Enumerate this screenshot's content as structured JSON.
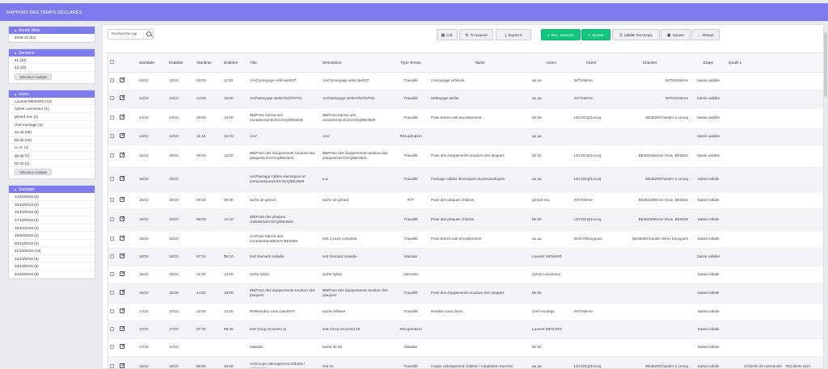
{
  "header": {
    "title": "RAPPORT DES TEMPS DÉCLARÉS"
  },
  "sidebar": {
    "panels": [
      {
        "title": "Année Mois",
        "items": [
          "2019-10 (62)"
        ],
        "multi": ""
      },
      {
        "title": "Semaine",
        "items": [
          "41 (20)",
          "42 (42)"
        ],
        "multi": "Sélection multiple"
      },
      {
        "title": "Users",
        "items": [
          "Laurent MENARD (12)",
          "Sylvie Lanonneur (1)",
          "gérard truc (2)",
          "chef montage (3)",
          "aa aa (26)",
          "bb bb (15)",
          "cc cc (1)",
          "gg gg (1)",
          "hh hh (1)"
        ],
        "multi": "Sélection multiple"
      },
      {
        "title": "Startdate",
        "items": [
          "14/10/2019 (4)",
          "15/10/2019 (2)",
          "16/10/2019 (6)",
          "17/10/2019 (3)",
          "18/10/2019 (2)",
          "19/10/2019 (2)",
          "20/10/2019 (1)",
          "21/10/2019 (13)",
          "22/10/2019 (6)",
          "23/10/2019 (6)",
          "24/10/2019 (8)"
        ],
        "multi": ""
      }
    ]
  },
  "toolbar": {
    "search_placeholder": "Recherche rap",
    "col": "Col.",
    "tri": "Tri avancé",
    "export": "Export",
    "rec": "Rec. avancée",
    "ajouter": "Ajouter",
    "valider": "Valider les temps",
    "sauver": "Sauver",
    "retour": "Retour"
  },
  "table": {
    "columns": [
      "",
      "",
      "Startdate",
      "Enddate",
      "Starttime",
      "Endtime",
      "Title",
      "Description",
      "Type Temps",
      "Tache",
      "Users",
      "Client",
      "Chantier",
      "Etape",
      "Qualif 1",
      ""
    ],
    "rows": [
      [
        "14/10",
        "14/10",
        "09:00",
        "11:00",
        "AA/Convoyage véhicule/INT.",
        "AA/Convoyage véhicule/INT.",
        "Travaillé",
        "Convoyage véhicule",
        "aa aa",
        "INT/Interne",
        "INT01/Interne",
        "Saisie validée",
        "",
        ""
      ],
      [
        "14/10",
        "14/10",
        "14:00",
        "16:00",
        "AA/Nettoyage atelier/INT/INT01",
        "AA/Nettoyage atelier/INT/INT01",
        "Travaillé",
        "Nettoyage atelier",
        "aa aa",
        "INT/Interne",
        "INT01/Interne",
        "Saisie validée",
        "",
        ""
      ],
      [
        "14/10",
        "14/10",
        "09:00",
        "13:00",
        "BB/Pose barres anti enrastrement/LECOCQ/BE3629",
        "BB/Pose barres anti enrastrement/LECOCQ/BE3629",
        "Travaillé",
        "Pose barres anti encastrement",
        "bb bb",
        "LECOCQ/Lecoq",
        "BE3629/Chantier 2 Lecoq",
        "Saisie validée",
        "",
        ""
      ],
      [
        "14/10",
        "14/10",
        "11:15",
        "13:15",
        "AA//",
        "AA//",
        "Récupération",
        "",
        "aa aa",
        "",
        "",
        "Saisie validée",
        "",
        ""
      ],
      [
        "15/10",
        "15/10",
        "09:00",
        "13:00",
        "BB/Pose des équipements soudure des plaques/LECOCQ/BE3622",
        "BB/Pose des équipements soudure des plaques/LECOCQ/BE3622",
        "Travaillé",
        "Pose des équipements soudure des plaques",
        "bb bb",
        "LECOCQ/Lecoq",
        "BE3622/Benne Grue, BE3622",
        "Saisie validée",
        "",
        ""
      ],
      [
        "15/10",
        "15/10",
        "",
        "",
        "AA/Passage câbles électriques et pneumatiques/LECOCQ/BE3629",
        "a a",
        "Travaillé",
        "Passage câbles électriques et pneumatiques",
        "aa aa",
        "LECOCQ/Lecoq",
        "BE3629/Chantier 2 Lecoq",
        "Saisie initiale",
        "",
        ""
      ],
      [
        "16/10",
        "16/10",
        "09:30",
        "09:30",
        "tache de gérard",
        "tache de gérard",
        "RTT",
        "Pose des plaques châssis",
        "gérard truc",
        "INT/Interne",
        "BE3622/Benne Grue, BE3622",
        "Saisie initiale",
        "",
        ""
      ],
      [
        "16/10",
        "16/10",
        "09:00",
        "12:30",
        "BB/Pose des plaques châssis/LECOCQ/BE3622",
        "",
        "Travaillé",
        "Pose des plaques châssis",
        "bb bb",
        "LECOCQ/Lecoq",
        "BE3622/Benne Grue, BE3622",
        "Saisie initiale",
        "",
        ""
      ],
      [
        "16/10",
        "16/10",
        "",
        "",
        "AA/Pose barres anti enrastrement/BOUY/BE3509",
        "test 2 jours complets",
        "Travaillé",
        "Pose barres anti encastrement",
        "aa aa",
        "BOUY/Bouygues",
        "BE3509/Chantier démo bouygues",
        "Saisie initiale",
        "",
        ""
      ],
      [
        "16/10",
        "16/10",
        "07:10",
        "09:10",
        "test lmenard maladie",
        "test lmenard maladie",
        "Maladie",
        "",
        "Laurent MENARD",
        "",
        "",
        "Saisie validée",
        "",
        ""
      ],
      [
        "16/10",
        "16/10",
        "11:30",
        "13:00",
        "tache sylvie",
        "tache sylvie",
        "Astreinte",
        "",
        "Sylvie Lanonneur",
        "",
        "",
        "Saisie initiale",
        "",
        ""
      ],
      [
        "16/10",
        "16/10",
        "14:00",
        "18:00",
        "BB/Pose des équipements soudure des plaques/",
        "BB/Pose des équipements soudure des plaques/",
        "Travaillé",
        "Pose des équipements soudure des plaques",
        "bb bb",
        "",
        "",
        "Saisie initiale",
        "",
        ""
      ],
      [
        "17/10",
        "17/10",
        "10:00",
        "14:00",
        "ÉM/Rendez vous client/INT.",
        "tache d'éliane",
        "Travaillé",
        "Rendez vous client",
        "chef montage",
        "INT/Interne",
        "",
        "Saisie initiale",
        "",
        ""
      ],
      [
        "17/10",
        "17/10",
        "07:30",
        "08:30",
        "test récup recurrent 2j",
        "test récup recurrent 2h",
        "Récupération",
        "",
        "Laurent MENARD",
        "",
        "",
        "Saisie initiale",
        "",
        ""
      ],
      [
        "17/10",
        "17/10",
        "",
        "",
        "Maladie",
        "tache de bb",
        "Maladie",
        "",
        "bb bb",
        "",
        "",
        "Saisie initiale",
        "",
        ""
      ],
      [
        "18/10",
        "18/10",
        "08:00",
        "16:00",
        "AA/Coupe rallongement châssis / Adaptation",
        "test lm",
        "Travaillé",
        "Coupe rallongement châssis / Adaptation traverse",
        "aa aa",
        "LECOCQ/Lecoq",
        "BE3629/Chantier 2 Lecoq",
        "Saisie initiale",
        "1/Clients de normandie",
        "76/Clients Sein"
      ]
    ]
  }
}
